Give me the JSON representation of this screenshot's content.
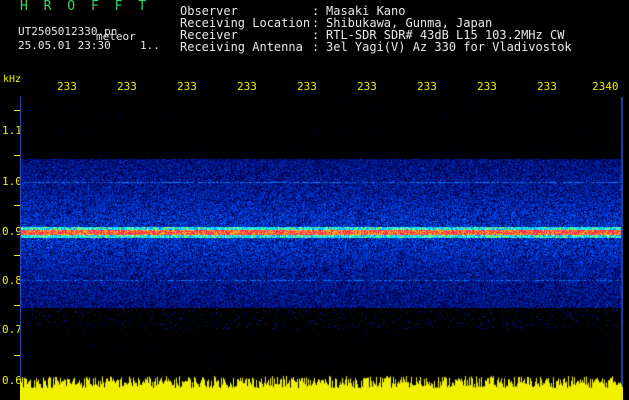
{
  "header": {
    "title": "H R O F F T",
    "filename": "UT2505012330.pn",
    "detector": "meteor",
    "datetime": "25.05.01 23:30",
    "count": "1.."
  },
  "info": [
    {
      "label": "Observer",
      "value": "Masaki Kano"
    },
    {
      "label": "Receiving Location",
      "value": "Shibukawa, Gunma, Japan"
    },
    {
      "label": "Receiver",
      "value": "RTL-SDR SDR# 43dB L15 103.2MHz CW"
    },
    {
      "label": "Receiving Antenna",
      "value": "3el Yagi(V) Az 330 for Vladivostok"
    }
  ],
  "axis": {
    "unit": "kHz",
    "time_ticks": [
      "233",
      "233",
      "233",
      "233",
      "233",
      "233",
      "233",
      "233",
      "233",
      "2340"
    ],
    "freq_ticks": [
      "1.1",
      "1.0",
      "0.9",
      "0.8",
      "0.7",
      "0.6"
    ]
  },
  "colors": {
    "label_white": "#e8e8e8",
    "title_green": "#30d860",
    "axis_yellow": "#f0f000",
    "background": "#000000"
  }
}
